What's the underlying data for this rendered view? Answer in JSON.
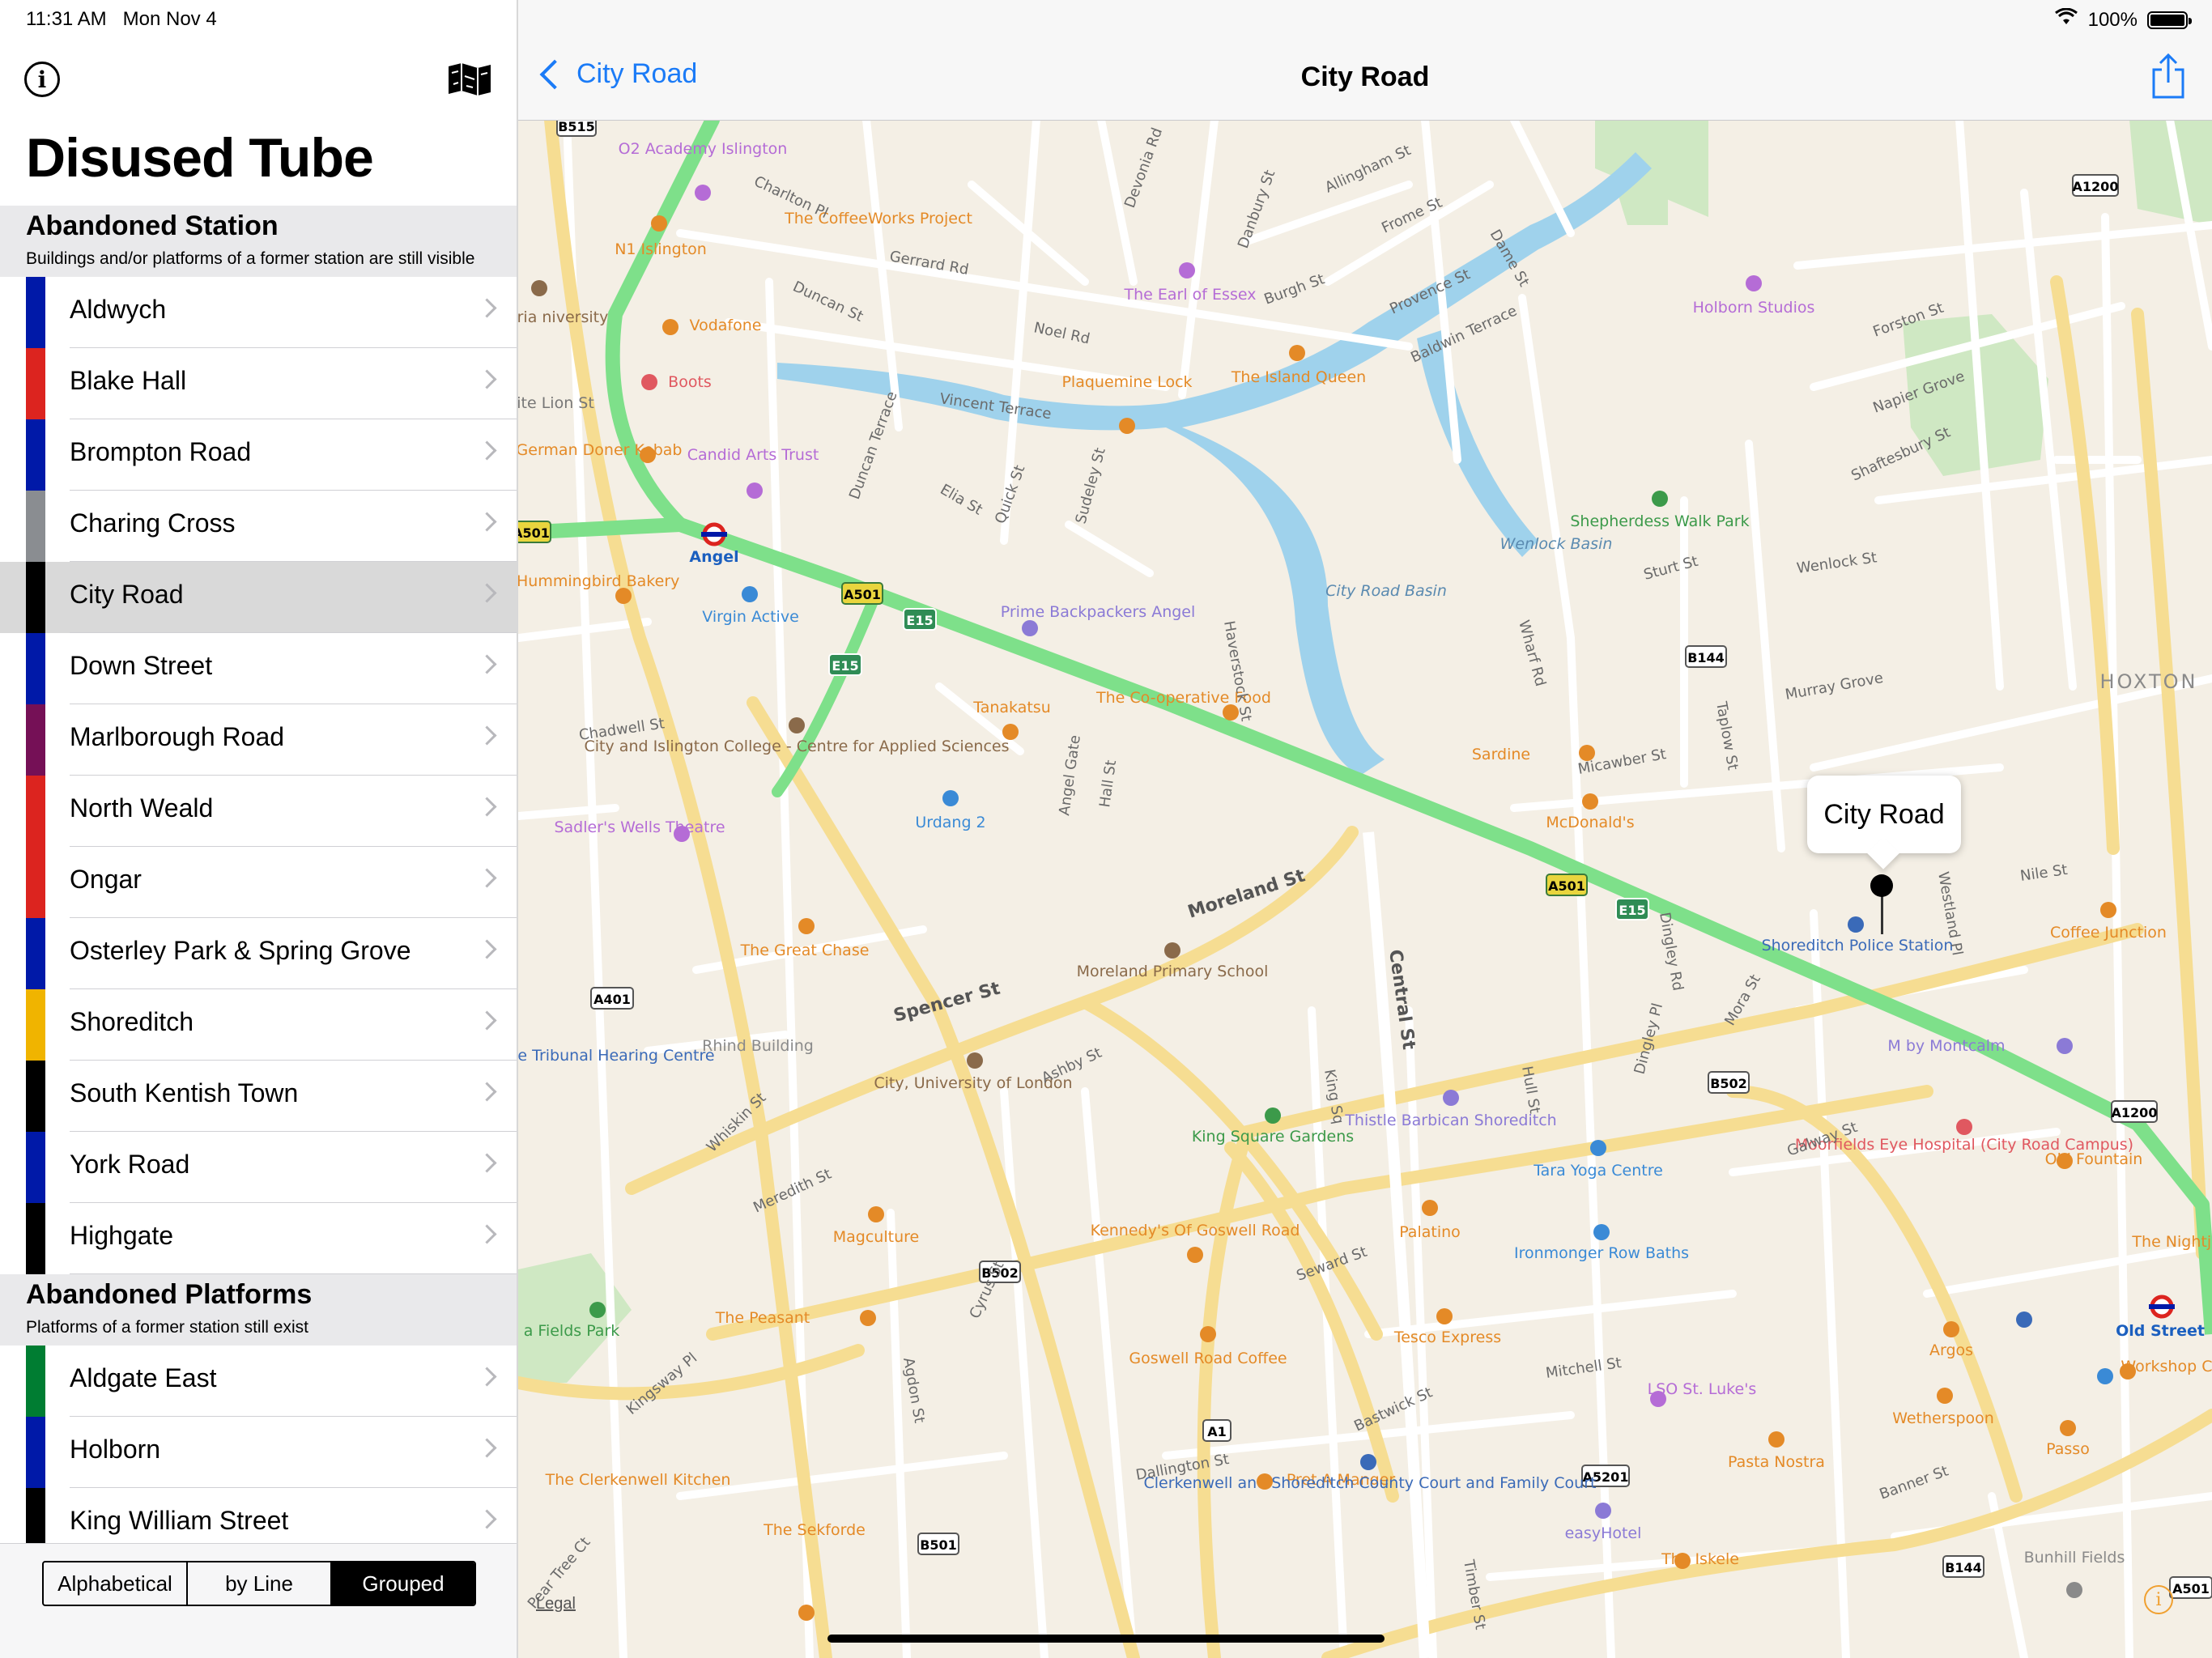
{
  "status": {
    "time": "11:31 AM",
    "date": "Mon Nov 4",
    "battery": "100%",
    "battery_level": 1.0
  },
  "sidebar": {
    "title": "Disused Tube",
    "sections": [
      {
        "header": "Abandoned Station",
        "subtitle": "Buildings and/or platforms of a former station are still visible"
      },
      {
        "header": "Abandoned Platforms",
        "subtitle": "Platforms of a former station still exist"
      }
    ],
    "stations": [
      {
        "label": "Aldwych",
        "color": "#0019a8"
      },
      {
        "label": "Blake Hall",
        "color": "#dc241f"
      },
      {
        "label": "Brompton Road",
        "color": "#0019a8"
      },
      {
        "label": "Charing Cross",
        "color": "#8a8d91"
      },
      {
        "label": "City Road",
        "color": "#000000"
      },
      {
        "label": "Down Street",
        "color": "#0019a8"
      },
      {
        "label": "Marlborough Road",
        "color": "#751056"
      },
      {
        "label": "North Weald",
        "color": "#dc241f"
      },
      {
        "label": "Ongar",
        "color": "#dc241f"
      },
      {
        "label": "Osterley Park & Spring Grove",
        "color": "#0019a8"
      },
      {
        "label": "Shoreditch",
        "color": "#f0b400"
      },
      {
        "label": "South Kentish Town",
        "color": "#000000"
      },
      {
        "label": "York Road",
        "color": "#0019a8"
      },
      {
        "label": "Highgate",
        "color": "#000000"
      }
    ],
    "platforms": [
      {
        "label": "Aldgate East",
        "color": "#007d32"
      },
      {
        "label": "Holborn",
        "color": "#0019a8"
      },
      {
        "label": "King William Street",
        "color": "#000000"
      }
    ],
    "segments": [
      "Alphabetical",
      "by Line",
      "Grouped"
    ]
  },
  "nav": {
    "back_label": "City Road",
    "title": "City Road"
  },
  "map": {
    "callout": "City Road",
    "legal": "Legal",
    "info": "i",
    "labels": {
      "B515": "B515",
      "academy": "O2 Academy Islington",
      "coffeeworks": "The CoffeeWorks Project",
      "n1": "N1 Islington",
      "vodafone": "Vodafone",
      "boots": "Boots",
      "earl": "The Earl of Essex",
      "plaquemine": "Plaquemine Lock",
      "island": "The Island Queen",
      "holborn_studios": "Holborn Studios",
      "a1200": "A1200",
      "candid": "Candid Arts Trust",
      "german": "German Doner Kebab",
      "a501": "A501",
      "angel": "Angel",
      "virgin": "Virgin Active",
      "e15": "E15",
      "prime": "Prime Backpackers Angel",
      "shepherdess": "Shepherdess Walk Park",
      "wenlock": "Wenlock Basin",
      "cityroadbasin": "City Road Basin",
      "hummingbird": "The Hummingbird Bakery",
      "tanakatsu": "Tanakatsu",
      "coop": "The Co-operative Food",
      "sardine": "Sardine",
      "mcdonalds": "McDonald's",
      "hoxton": "HOXTON",
      "b144": "B144",
      "college": "City and Islington College - Centre for Applied Sciences",
      "urdang": "Urdang 2",
      "sadlers": "Sadler's Wells Theatre",
      "moreland_st": "Moreland St",
      "great_chase": "The Great Chase",
      "moreland_school": "Moreland Primary School",
      "central_st": "Central St",
      "police": "Shoreditch Police Station",
      "coffee_junction": "Coffee Junction",
      "a401": "A401",
      "spencer_st": "Spencer St",
      "taylor": "Taylor House Tribunal Hearing Centre",
      "rhind": "Rhind Building",
      "city_uni": "City, University of London",
      "mbym": "M by Montcalm",
      "b502": "B502",
      "king_sq": "King Square Gardens",
      "thistle": "Thistle Barbican Shoreditch",
      "tara": "Tara Yoga Centre",
      "moorfields": "Moorfields Eye Hospital (City Road Campus)",
      "old_fountain": "Old Fountain",
      "a1200b": "A1200",
      "kennedys": "Kennedy's Of Goswell Road",
      "palatino": "Palatino",
      "magculture": "Magculture",
      "ironmonger": "Ironmonger Row Baths",
      "nightjar": "The Nightjar",
      "fields_park": "a Fields Park",
      "peasant": "The Peasant",
      "goswell": "Goswell Road Coffee",
      "tesco": "Tesco Express",
      "argos": "Argos",
      "old_street": "Old Street",
      "lso": "LSO St. Luke's",
      "workshop": "Workshop Coffee",
      "wetherspoon": "Wetherspoon",
      "a1": "A1",
      "pret": "Pret A Manger",
      "pasta": "Pasta Nostra",
      "clerkenwell_kitchen": "The Clerkenwell Kitchen",
      "county_court": "Clerkenwell and Shoreditch County Court and Family Court",
      "a5201": "A5201",
      "passo": "Passo",
      "easyhotel": "easyHotel",
      "sekforde": "The Sekforde",
      "b501": "B501",
      "iskele": "The Iskele",
      "b144b": "B144",
      "bunhill": "Bunhill Fields",
      "a501b": "A501",
      "academy2": "Academy",
      "thumbria": "rthumbria niversity",
      "hite_lion": "hite Lion St",
      "charlton": "Charlton Pl",
      "gerrard": "Gerrard Rd",
      "duncan": "Duncan St",
      "noel": "Noel Rd",
      "vincent": "Vincent Terrace",
      "burgh": "Burgh St",
      "devonia": "Devonia Rd",
      "danbury": "Danbury St",
      "frome": "Frome St",
      "provence": "Provence St",
      "baldwin": "Baldwin Terrace",
      "dame": "Dame St",
      "allingham": "Allingham St",
      "duncan_terrace": "Duncan Terrace",
      "elia": "Elia St",
      "quick": "Quick St",
      "sudeley": "Sudeley St",
      "forston": "Forston St",
      "napier": "Napier Grove",
      "shaftesbury": "Shaftesbury St",
      "sturt": "Sturt St",
      "wenlock_st": "Wenlock St",
      "haverstock": "Haverstock St",
      "wharf": "Wharf Rd",
      "chadwell": "Chadwell St",
      "angel_gate": "Angel Gate",
      "hall": "Hall St",
      "micawber": "Micawber St",
      "murray": "Murray Grove",
      "taplow": "Taplow St",
      "nile": "Nile St",
      "westland": "Westland Pl",
      "dingley_rd": "Dingley Rd",
      "mora": "Mora St",
      "dingley_pl": "Dingley Pl",
      "ashby": "Ashby St",
      "whiskin": "Whiskin St",
      "king_sq_st": "King Sq",
      "hull": "Hull St",
      "galway": "Galway St",
      "meredith": "Meredith St",
      "seward": "Seward St",
      "mitchell": "Mitchell St",
      "cyrus": "Cyrus St",
      "agdon": "Agdon St",
      "bastwick": "Bastwick St",
      "dallington": "Dallington St",
      "banner": "Banner St",
      "timber": "Timber St",
      "kingsway": "Kingsway Pl",
      "peartree": "Pear Tree Ct"
    }
  }
}
